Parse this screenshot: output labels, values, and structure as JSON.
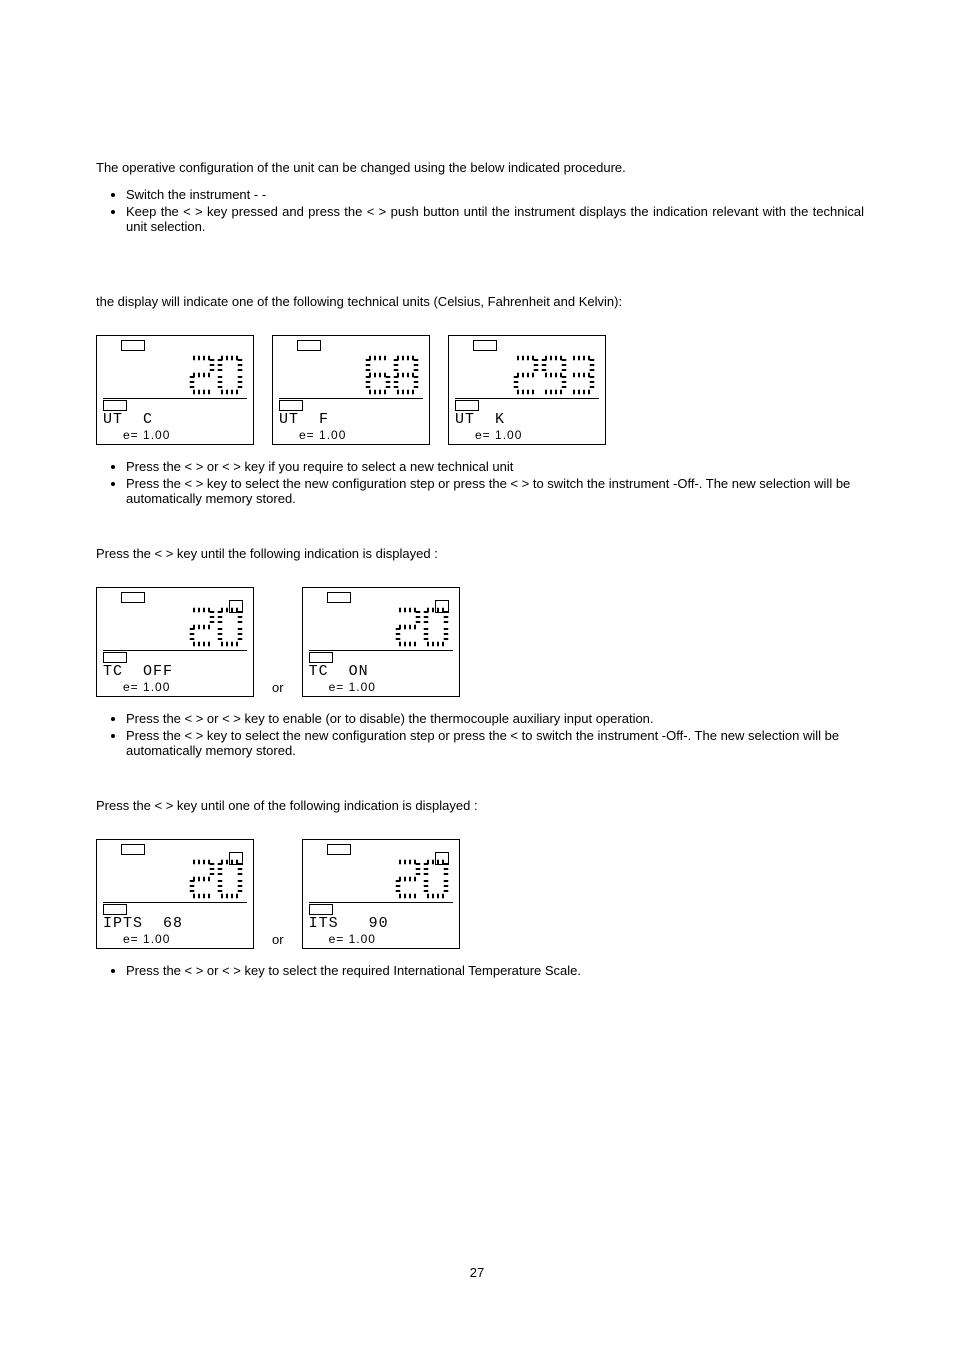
{
  "intro": "The operative configuration of the unit can be changed using the below indicated procedure.",
  "steps1": [
    "Switch the instrument -    -",
    "Keep the <        > key pressed and press the <        > push button until the instrument displays the indication relevant with the technical unit selection."
  ],
  "tech_units_line": "the display will indicate one of the following technical units (Celsius, Fahrenheit and Kelvin):",
  "lcd_panels_1": [
    {
      "big": "20",
      "bottom": "UT  C",
      "e": "e= 1.00",
      "small_top_right": false
    },
    {
      "big": "68",
      "bottom": "UT  F",
      "e": "e= 1.00",
      "small_top_right": false
    },
    {
      "big": "293",
      "bottom": "UT  K",
      "e": "e= 1.00",
      "small_top_right": false
    }
  ],
  "steps2": [
    "Press the <   > or <   > key if you require to select a new technical unit",
    "Press the <      > key to select the new configuration step or press the <         > to switch the instrument -Off-. The new selection will be automatically memory stored."
  ],
  "press_until_1": "Press the <      > key until the following indication is displayed :",
  "lcd_panels_2": [
    {
      "big": "20",
      "bottom": "TC  OFF",
      "e": "e= 1.00",
      "small_top_right": true
    },
    {
      "big": "20",
      "bottom": "TC  ON",
      "e": "e= 1.00",
      "small_top_right": true
    }
  ],
  "or_label": "or",
  "steps3": [
    "Press the <   > or <   > key to enable (or to disable) the thermocouple auxiliary input operation.",
    "Press the <      > key to select the new configuration step or press the <          to switch the instrument -Off-. The new selection will be automatically memory stored."
  ],
  "press_until_2": "Press the <      > key until one of the following indication is displayed :",
  "lcd_panels_3": [
    {
      "big": "20",
      "bottom": "IPTS  68",
      "e": "e= 1.00",
      "small_top_right": true
    },
    {
      "big": "20",
      "bottom": "ITS   90",
      "e": "e= 1.00",
      "small_top_right": true
    }
  ],
  "steps4": [
    "Press the <   > or <   > key to select the required International Temperature Scale."
  ],
  "page_number": "27"
}
